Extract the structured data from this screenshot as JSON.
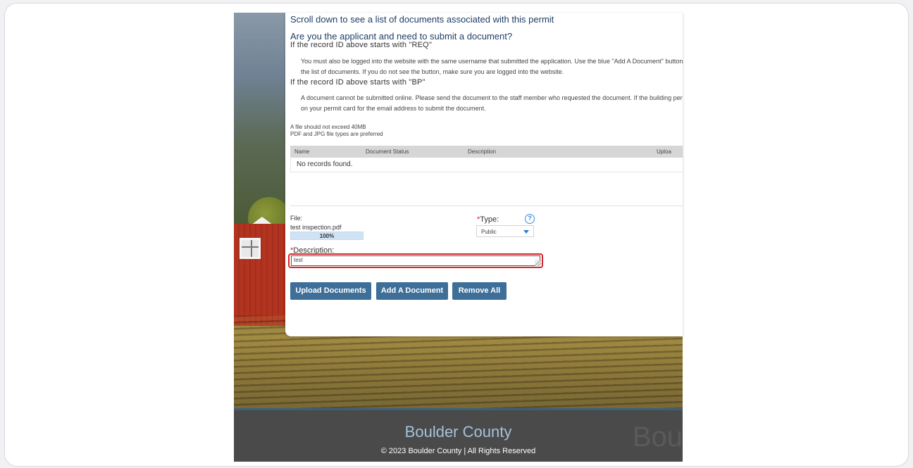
{
  "permit_docs": {
    "scroll_hint": "Scroll down to see a list of documents associated with this permit",
    "applicant_heading": "Are you the applicant and need to submit a document?",
    "req_heading": "If the record ID above starts with \"REQ\"",
    "req_body_line1": "You must also be logged into the website with the same username that submitted the application. Use the blue \"Add A Document\" button to upl",
    "req_body_line2": "the list of documents. If you do not see the button, make sure you are logged into the website.",
    "bp_heading": "If the record ID above starts with \"BP\"",
    "bp_body_line1": "A document cannot be submitted online. Please send the document to the staff member who requested the document. If the building permit ha",
    "bp_body_line2": "on your permit card for the email address to submit the document.",
    "limit_line1": "A file should not exceed 40MB",
    "limit_line2": "PDF and JPG file types are preferred"
  },
  "documents_table": {
    "columns": [
      "Name",
      "Document Status",
      "Description",
      "Uploa"
    ],
    "empty_message": "No records found."
  },
  "upload_form": {
    "file_label": "File:",
    "file_name": "test inspection.pdf",
    "progress_text": "100%",
    "progress_fraction": 1.0,
    "type_label": "Type:",
    "required_mark": "*",
    "help_icon": "question-circle-icon",
    "type_value": "Public",
    "description_label": "Description:",
    "description_value": "test"
  },
  "buttons": {
    "upload": "Upload Documents",
    "add": "Add A Document",
    "remove_all": "Remove All"
  },
  "footer": {
    "title": "Boulder County",
    "copyright": "© 2023 Boulder County | All Rights Reserved",
    "watermark": "Bou"
  },
  "colors": {
    "button_blue": "#3e6f99",
    "heading_navy": "#1f3d66",
    "highlight_red": "#d7262b",
    "footer_title": "#a6c2da"
  }
}
